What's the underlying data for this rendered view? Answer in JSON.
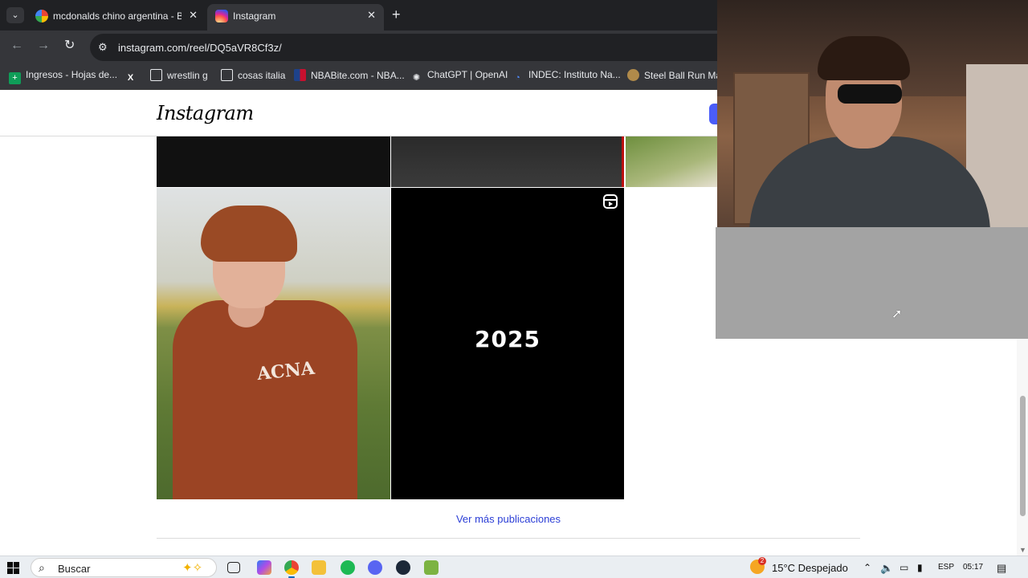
{
  "browser": {
    "tabs": [
      {
        "title": "mcdonalds chino argentina - Bu",
        "favicon": "google-icon"
      },
      {
        "title": "Instagram",
        "favicon": "instagram-icon"
      }
    ],
    "url": "instagram.com/reel/DQ5aVR8Cf3z/",
    "bookmarks": [
      {
        "label": "Ingresos - Hojas de...",
        "icon": "sheets-icon"
      },
      {
        "label": "",
        "icon": "x-icon"
      },
      {
        "label": "wrestlin g",
        "icon": "folder-icon"
      },
      {
        "label": "cosas italia",
        "icon": "folder-icon"
      },
      {
        "label": "NBABite.com - NBA...",
        "icon": "nba-icon"
      },
      {
        "label": "ChatGPT | OpenAI",
        "icon": "openai-icon"
      },
      {
        "label": "INDEC: Instituto Na...",
        "icon": "indec-icon"
      },
      {
        "label": "Steel Ball Run Man",
        "icon": "sbr-icon"
      }
    ]
  },
  "instagram": {
    "logo": "Instagram",
    "tile_text": "2025",
    "shirt_print": "ACNA",
    "more_link": "Ver más publicaciones"
  },
  "taskbar": {
    "search_placeholder": "Buscar",
    "weather_badge": "2",
    "weather": "15°C  Despejado",
    "language": "ESP",
    "time": "05:17"
  },
  "colors": {
    "chrome_dark": "#202124",
    "chrome_toolbar": "#35363a",
    "link_blue": "#2b3ed6",
    "taskbar_bg": "#eaeef2"
  }
}
